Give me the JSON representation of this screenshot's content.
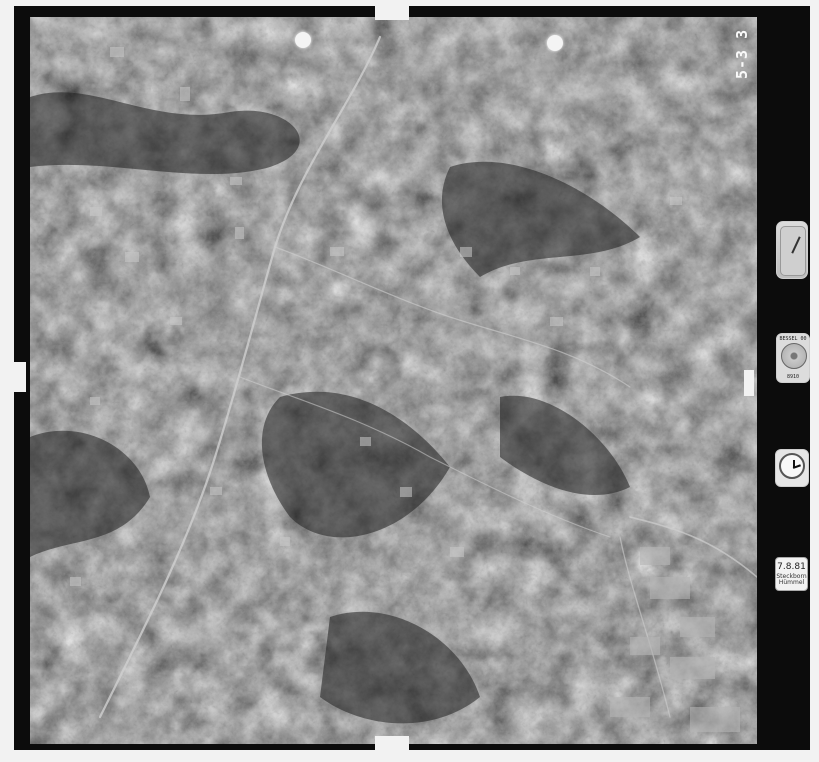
{
  "photo": {
    "frame_id": "5-3 3",
    "subject": "aerial-terrain-photograph",
    "palette": {
      "frame": "#0c0c0c",
      "base": "#4b4b4b",
      "highlight": "#bdbdbd",
      "shadow": "#1e1e1e",
      "background": "#f2f2f2"
    }
  },
  "instruments": {
    "altimeter": {
      "icon": "altimeter-icon"
    },
    "level": {
      "icon": "level-icon",
      "text_top": "BESSEL 00",
      "text_bottom": "8910"
    },
    "clock": {
      "icon": "clock-icon"
    },
    "data_card": {
      "date": "7.8.81",
      "sub_line1": "Steckborn",
      "sub_line2": "Hümmel"
    }
  }
}
